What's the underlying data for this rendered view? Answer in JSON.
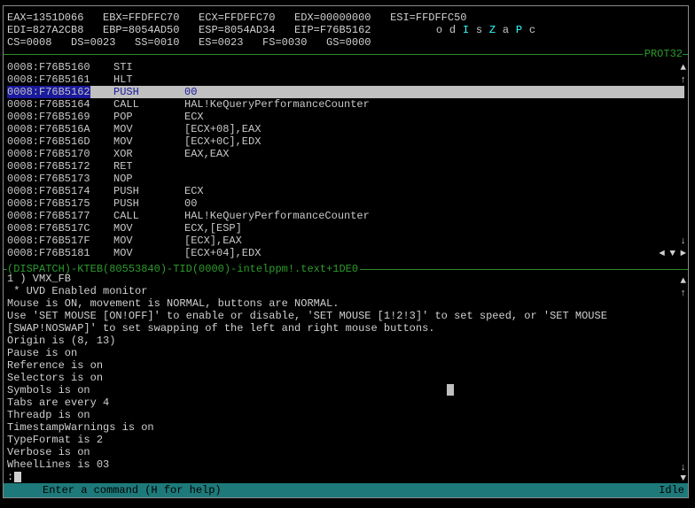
{
  "registers": {
    "row1": "EAX=1351D066   EBX=FFDFFC70   ECX=FFDFFC70   EDX=00000000   ESI=FFDFFC50",
    "row2": "EDI=827A2CB8   EBP=8054AD50   ESP=8054AD34   EIP=F76B5162",
    "row3": "CS=0008   DS=0023   SS=0010   ES=0023   FS=0030   GS=0000"
  },
  "flags": [
    {
      "ch": "o",
      "set": false
    },
    {
      "ch": "d",
      "set": false
    },
    {
      "ch": "I",
      "set": true
    },
    {
      "ch": "s",
      "set": false
    },
    {
      "ch": "Z",
      "set": true
    },
    {
      "ch": "a",
      "set": false
    },
    {
      "ch": "P",
      "set": true
    },
    {
      "ch": "c",
      "set": false
    }
  ],
  "mode_label": "PROT32",
  "code": [
    {
      "addr": "0008:F76B5160",
      "mn": "STI",
      "op": ""
    },
    {
      "addr": "0008:F76B5161",
      "mn": "HLT",
      "op": ""
    },
    {
      "addr": "0008:F76B5162",
      "mn": "PUSH",
      "op": "00"
    },
    {
      "addr": "0008:F76B5164",
      "mn": "CALL",
      "op": "HAL!KeQueryPerformanceCounter"
    },
    {
      "addr": "0008:F76B5169",
      "mn": "POP",
      "op": "ECX"
    },
    {
      "addr": "0008:F76B516A",
      "mn": "MOV",
      "op": "[ECX+08],EAX"
    },
    {
      "addr": "0008:F76B516D",
      "mn": "MOV",
      "op": "[ECX+0C],EDX"
    },
    {
      "addr": "0008:F76B5170",
      "mn": "XOR",
      "op": "EAX,EAX"
    },
    {
      "addr": "0008:F76B5172",
      "mn": "RET",
      "op": ""
    },
    {
      "addr": "0008:F76B5173",
      "mn": "NOP",
      "op": ""
    },
    {
      "addr": "0008:F76B5174",
      "mn": "PUSH",
      "op": "ECX"
    },
    {
      "addr": "0008:F76B5175",
      "mn": "PUSH",
      "op": "00"
    },
    {
      "addr": "0008:F76B5177",
      "mn": "CALL",
      "op": "HAL!KeQueryPerformanceCounter"
    },
    {
      "addr": "0008:F76B517C",
      "mn": "MOV",
      "op": "ECX,[ESP]"
    },
    {
      "addr": "0008:F76B517F",
      "mn": "MOV",
      "op": "[ECX],EAX"
    },
    {
      "addr": "0008:F76B5181",
      "mn": "MOV",
      "op": "[ECX+04],EDX"
    }
  ],
  "selected_index": 2,
  "context_line": "(DISPATCH)-KTEB(80553840)-TID(0000)-intelppm!.text+1DE0",
  "output": [
    "1 ) VMX_FB",
    " * UVD Enabled monitor",
    "Mouse is ON, movement is NORMAL, buttons are NORMAL.",
    "Use 'SET MOUSE [ON!OFF]' to enable or disable, 'SET MOUSE [1!2!3]' to set speed, or 'SET MOUSE",
    "[SWAP!NOSWAP]' to set swapping of the left and right mouse buttons.",
    "Origin is (8, 13)",
    "Pause is on",
    "Reference is on",
    "Selectors is on",
    "Symbols is on",
    "Tabs are every 4",
    "Threadp is on",
    "TimestampWarnings is on",
    "TypeFormat is 2",
    "Verbose is on",
    "WheelLines is 03"
  ],
  "prompt": ":",
  "status_help": "Enter a command (H for help)",
  "status_state": "Idle",
  "colors": {
    "accent_green": "#2c9c2c",
    "status_bar": "#1e7a7a",
    "flag_set": "#33ffff",
    "selection": "#1a1a9c"
  }
}
